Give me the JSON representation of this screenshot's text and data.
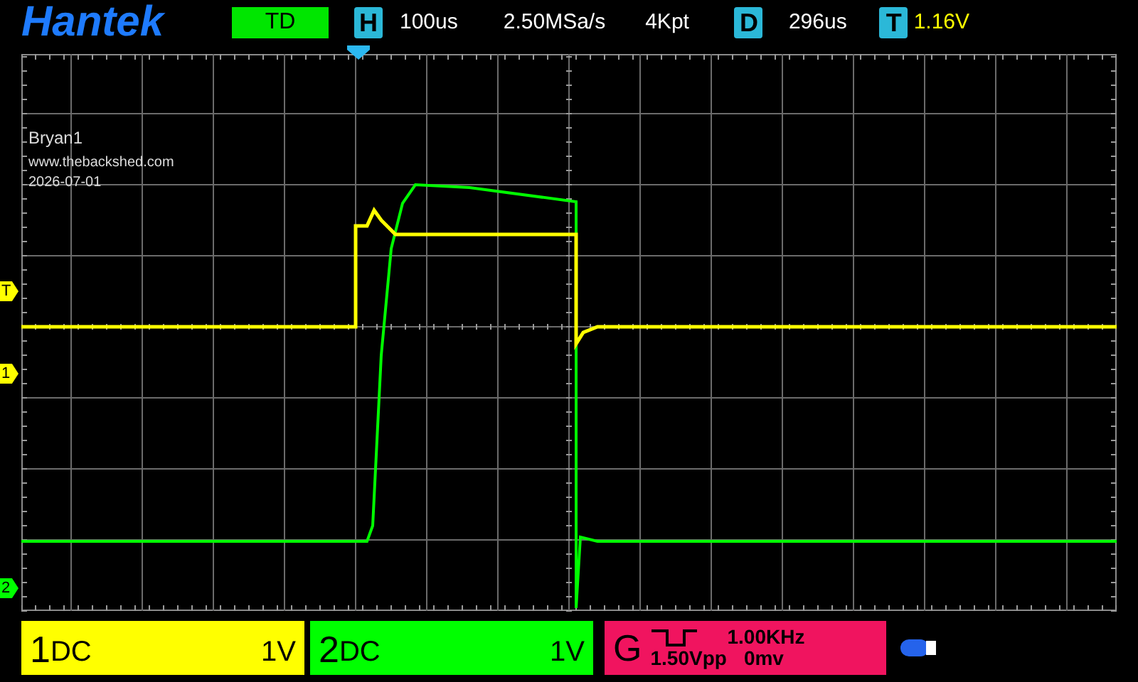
{
  "header": {
    "brand": "Hantek",
    "mode": "TD",
    "timebase": {
      "label": "H",
      "value": "100us"
    },
    "sample_rate": "2.50MSa/s",
    "memory_depth": "4Kpt",
    "delay": {
      "label": "D",
      "value": "296us"
    },
    "trigger": {
      "label": "T",
      "value": "1.16V"
    }
  },
  "screen": {
    "notes": [
      "Bryan1",
      "www.thebackshed.com",
      "2026-07-01"
    ],
    "markers": [
      {
        "kind": "trigger",
        "label": "T"
      },
      {
        "kind": "ch1",
        "label": "1"
      },
      {
        "kind": "ch2",
        "label": "2"
      }
    ]
  },
  "channels": [
    {
      "number": "1",
      "coupling": "DC",
      "scale": "1V",
      "color": "#ffff00"
    },
    {
      "number": "2",
      "coupling": "DC",
      "scale": "1V",
      "color": "#00ff00"
    }
  ],
  "generator": {
    "label": "G",
    "frequency": "1.00KHz",
    "amplitude": "1.50Vpp",
    "offset": "0mv"
  }
}
